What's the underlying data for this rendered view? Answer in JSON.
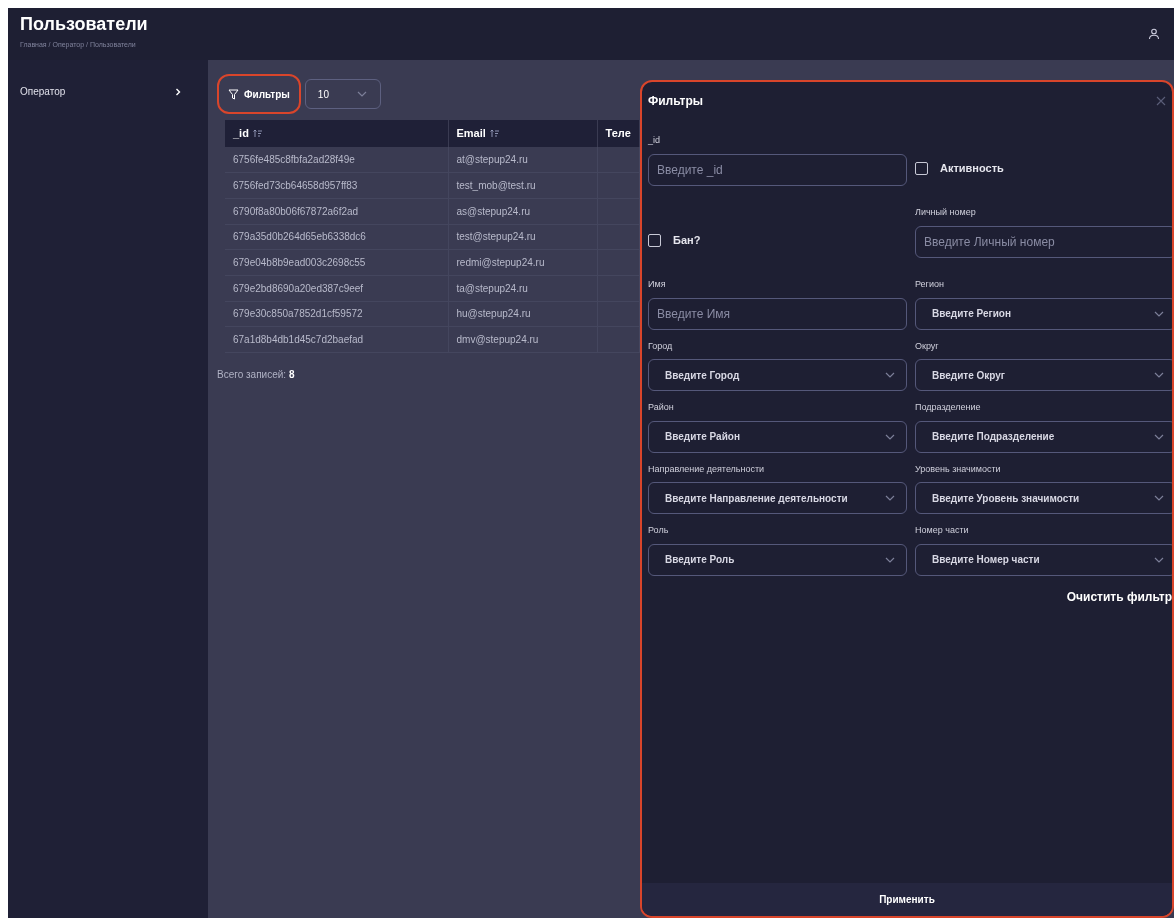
{
  "header": {
    "title": "Пользователи",
    "breadcrumb": "Главная / Оператор / Пользователи"
  },
  "sidebar": {
    "items": [
      {
        "label": "Оператор",
        "expanded": false
      }
    ]
  },
  "toolbar": {
    "filter_button": "Фильтры",
    "page_size": "10"
  },
  "table": {
    "columns": [
      "_id",
      "Email",
      "Теле"
    ],
    "rows": [
      [
        "6756fe485c8fbfa2ad28f49e",
        "at@stepup24.ru"
      ],
      [
        "6756fed73cb64658d957ff83",
        "test_mob@test.ru"
      ],
      [
        "6790f8a80b06f67872a6f2ad",
        "as@stepup24.ru"
      ],
      [
        "679a35d0b264d65eb6338dc6",
        "test@stepup24.ru"
      ],
      [
        "679e04b8b9ead003c2698c55",
        "redmi@stepup24.ru"
      ],
      [
        "679e2bd8690a20ed387c9eef",
        "ta@stepup24.ru"
      ],
      [
        "679e30c850a7852d1cf59572",
        "hu@stepup24.ru"
      ],
      [
        "67a1d8b4db1d45c7d2baefad",
        "dmv@stepup24.ru"
      ]
    ],
    "total_label": "Всего записей:",
    "total": "8"
  },
  "filter_panel": {
    "title": "Фильтры",
    "fields": [
      {
        "kind": "text",
        "label": "_id",
        "placeholder": "Введите _id"
      },
      {
        "kind": "checkbox",
        "label": "Активность",
        "checked": false
      },
      {
        "kind": "checkbox",
        "label": "Бан?",
        "checked": false
      },
      {
        "kind": "text",
        "label": "Личный номер",
        "placeholder": "Введите Личный номер"
      },
      {
        "kind": "text",
        "label": "Имя",
        "placeholder": "Введите Имя"
      },
      {
        "kind": "select",
        "label": "Регион",
        "placeholder": "Введите Регион"
      },
      {
        "kind": "select",
        "label": "Город",
        "placeholder": "Введите Город"
      },
      {
        "kind": "select",
        "label": "Округ",
        "placeholder": "Введите Округ"
      },
      {
        "kind": "select",
        "label": "Район",
        "placeholder": "Введите Район"
      },
      {
        "kind": "select",
        "label": "Подразделение",
        "placeholder": "Введите Подразделение"
      },
      {
        "kind": "select",
        "label": "Направление деятельности",
        "placeholder": "Введите Направление деятельности"
      },
      {
        "kind": "select",
        "label": "Уровень значимости",
        "placeholder": "Введите Уровень значимости"
      },
      {
        "kind": "select",
        "label": "Роль",
        "placeholder": "Введите Роль"
      },
      {
        "kind": "select",
        "label": "Номер части",
        "placeholder": "Введите Номер части"
      }
    ],
    "clear_button": "Очистить фильтр",
    "apply_button": "Применить"
  }
}
